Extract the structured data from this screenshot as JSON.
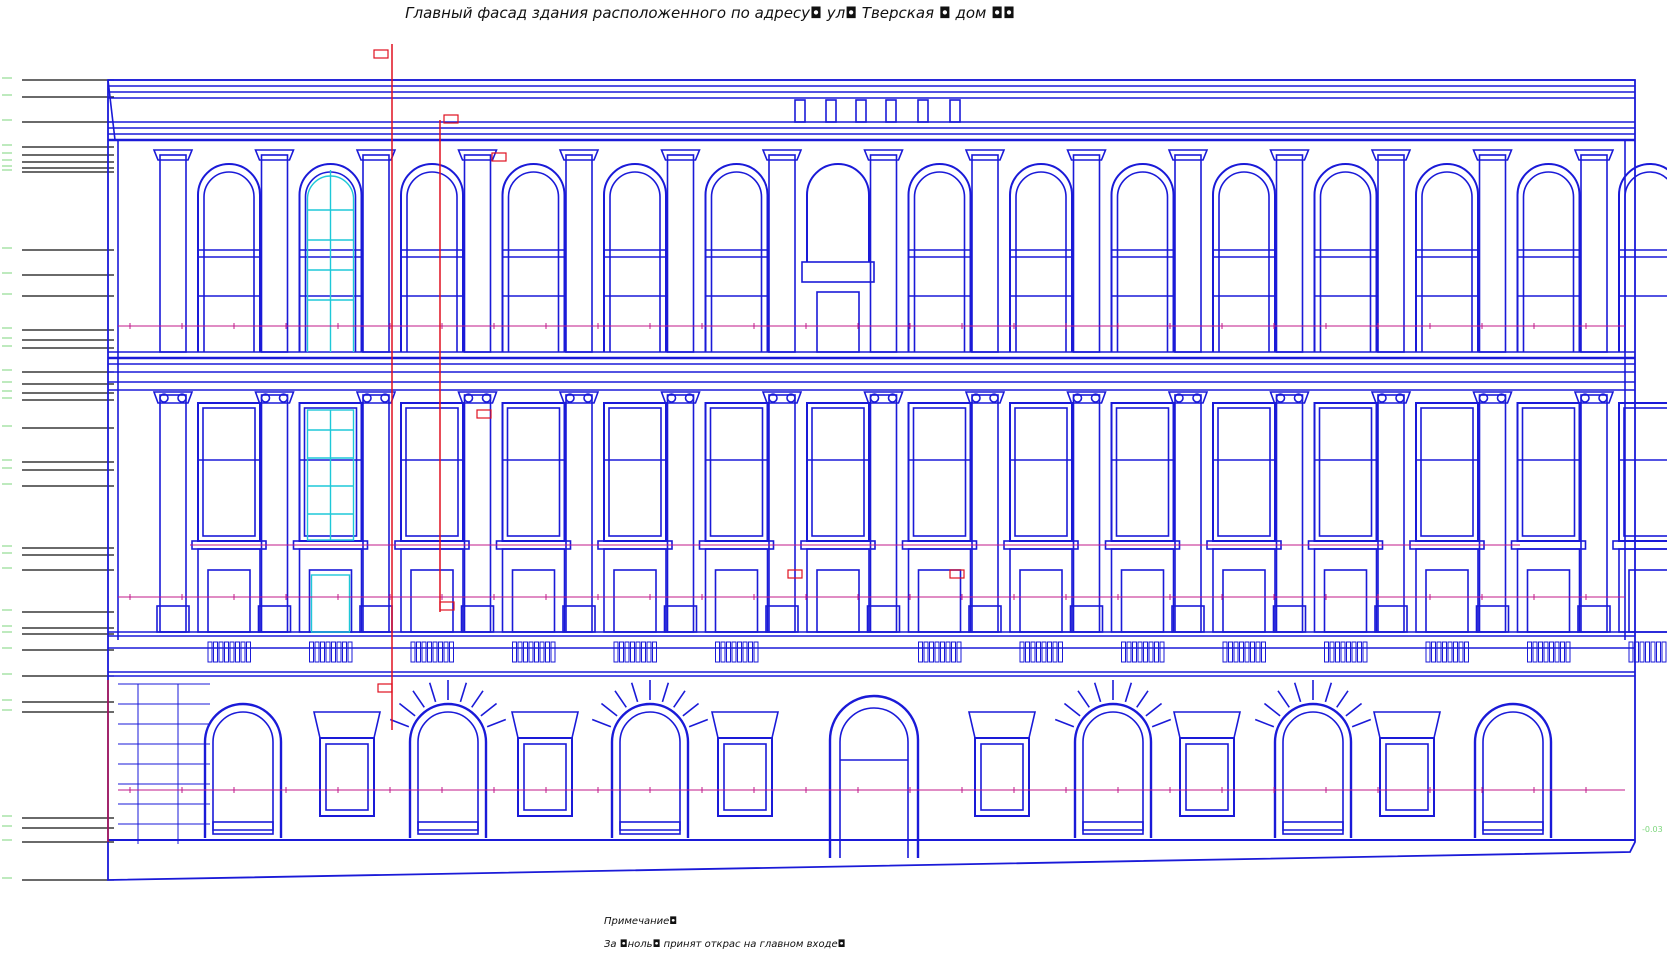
{
  "drawing": {
    "title": "Главный фасад здания расположенного по адресу◘ ул◘ Тверская ◘ дом ◘◘",
    "note_heading": "Примечание◘",
    "note_text": "За ◘ноль◘ принят открас на главном входе◘",
    "level_mark_right": "-0.03",
    "colors": {
      "line": "#1a1ad8",
      "accent": "#e01020",
      "dimension": "#c0188a",
      "highlight": "#1ec8d8",
      "level_text": "#7cd67c",
      "leader": "#111111"
    },
    "bays_upper": 14,
    "bays_ground": 14
  }
}
